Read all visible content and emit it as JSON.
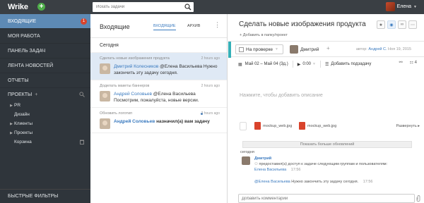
{
  "topbar": {
    "logo": "Wrike",
    "plus": "+",
    "search_placeholder": "Искать задачи",
    "user_name": "Елена"
  },
  "sidebar": {
    "items": [
      {
        "label": "Входящие",
        "badge": "1"
      },
      {
        "label": "Моя работа"
      },
      {
        "label": "Панель задач"
      },
      {
        "label": "Лента новостей"
      },
      {
        "label": "Отчеты"
      }
    ],
    "projects_label": "Проекты",
    "tree": [
      "PR",
      "Дизайн",
      "Клиенты",
      "Проекты",
      "Корзина"
    ],
    "filters_label": "Быстрые фильтры"
  },
  "inbox": {
    "title": "Входящие",
    "tabs": [
      "Входящие",
      "Архив"
    ],
    "section": "Сегодня",
    "items": [
      {
        "task": "Сделать новые изображения продукта",
        "time": "2 hours ago",
        "author": "Дмитрий Колесников",
        "text": "@Елена Васильева Нужно закончить эту задачу сегодня."
      },
      {
        "task": "Доделать макеты баннеров",
        "time": "2 hours ago",
        "author": "Андрей Соловьев",
        "text": "@Елена Васильева Посмотрим, пожалуйста, новые версии."
      },
      {
        "task": "Обновить логотип",
        "time": "2 hours ago",
        "author": "Андрей Соловьев",
        "text": "назначил(а) вам задачу"
      }
    ]
  },
  "task": {
    "title": "Сделать новые изображения продукта",
    "add_folder": "+ Добавить в папку/проект",
    "status": "На проверке",
    "assignee": "Дмитрий",
    "author_prefix": "автор:",
    "author_name": "Андрей С.",
    "author_date": "Ноя 19, 2015",
    "dates": "Май 02 – Май 04 (3д.)",
    "timer": "0:00",
    "add_subtask": "Добавить подзадачу",
    "subtask_count": "4",
    "description_placeholder": "Нажмите, чтобы добавить описание",
    "files": [
      "mockup_web.jpg",
      "mockup_web.jpg"
    ],
    "expand": "Развернуть",
    "show_more": "Показать больше обновлений",
    "today": "сегодня",
    "comment_author": "Дмитрий",
    "comment_line1": "предоставил(а) доступ к задаче следующим группам и пользователям:",
    "comment_user": "Елена Васильева",
    "comment_time1": "17:56",
    "comment_mention": "@Елена Васильева",
    "comment_text": "Нужно закончить эту задачу сегодня.",
    "comment_time2": "17:56",
    "comment_placeholder": "Добавить комментарий"
  },
  "colors": {
    "topbar": "#3a3f44",
    "sidebar": "#2f353b",
    "active": "#5d8ab5",
    "accent": "#3a7abf",
    "status_strip": "#35b0b8"
  }
}
